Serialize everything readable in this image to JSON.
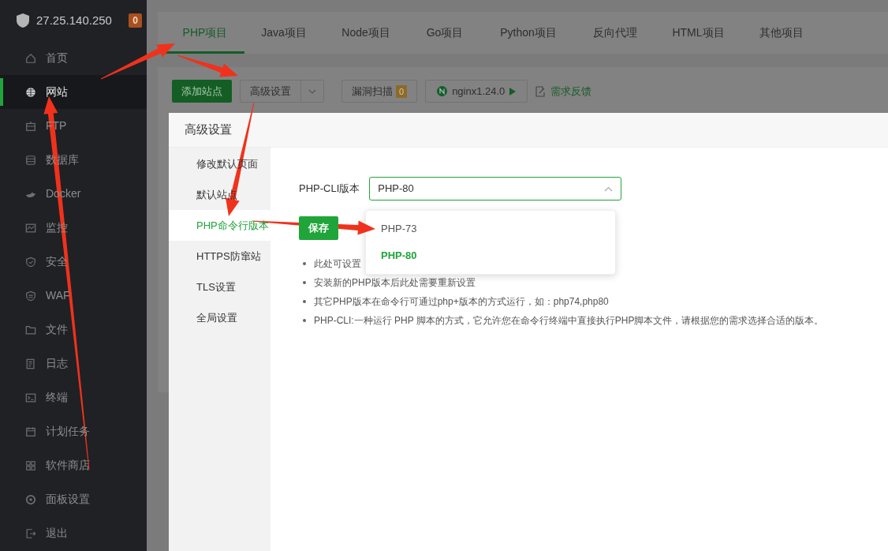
{
  "sidebar": {
    "host": "27.25.140.250",
    "badge": "0",
    "items": [
      {
        "label": "首页",
        "selected": false
      },
      {
        "label": "网站",
        "selected": true
      },
      {
        "label": "FTP",
        "selected": false
      },
      {
        "label": "数据库",
        "selected": false
      },
      {
        "label": "Docker",
        "selected": false
      },
      {
        "label": "监控",
        "selected": false
      },
      {
        "label": "安全",
        "selected": false
      },
      {
        "label": "WAF",
        "selected": false
      },
      {
        "label": "文件",
        "selected": false
      },
      {
        "label": "日志",
        "selected": false
      },
      {
        "label": "终端",
        "selected": false
      },
      {
        "label": "计划任务",
        "selected": false
      },
      {
        "label": "软件商店",
        "selected": false
      },
      {
        "label": "面板设置",
        "selected": false
      },
      {
        "label": "退出",
        "selected": false
      }
    ]
  },
  "tabs": [
    {
      "label": "PHP项目",
      "selected": true
    },
    {
      "label": "Java项目",
      "selected": false
    },
    {
      "label": "Node项目",
      "selected": false
    },
    {
      "label": "Go项目",
      "selected": false
    },
    {
      "label": "Python项目",
      "selected": false
    },
    {
      "label": "反向代理",
      "selected": false
    },
    {
      "label": "HTML项目",
      "selected": false
    },
    {
      "label": "其他项目",
      "selected": false
    }
  ],
  "toolbar": {
    "add_site": "添加站点",
    "advanced": "高级设置",
    "scan": "漏洞扫描",
    "scan_count": "0",
    "nginx": "nginx1.24.0",
    "feedback": "需求反馈"
  },
  "dialog": {
    "title": "高级设置",
    "nav": [
      {
        "label": "修改默认页面",
        "selected": false
      },
      {
        "label": "默认站点",
        "selected": false
      },
      {
        "label": "PHP命令行版本",
        "selected": true
      },
      {
        "label": "HTTPS防窜站",
        "selected": false
      },
      {
        "label": "TLS设置",
        "selected": false
      },
      {
        "label": "全局设置",
        "selected": false
      }
    ],
    "field_label": "PHP-CLI版本",
    "select_value": "PHP-80",
    "expanded": true,
    "save": "保存",
    "options": [
      {
        "label": "PHP-73",
        "selected": false
      },
      {
        "label": "PHP-80",
        "selected": true
      }
    ],
    "notes": [
      "此处可设置",
      "安装新的PHP版本后此处需要重新设置",
      "其它PHP版本在命令行可通过php+版本的方式运行，如：php74,php80",
      "PHP-CLI:一种运行 PHP 脚本的方式，它允许您在命令行终端中直接执行PHP脚本文件，请根据您的需求选择合适的版本。"
    ]
  }
}
